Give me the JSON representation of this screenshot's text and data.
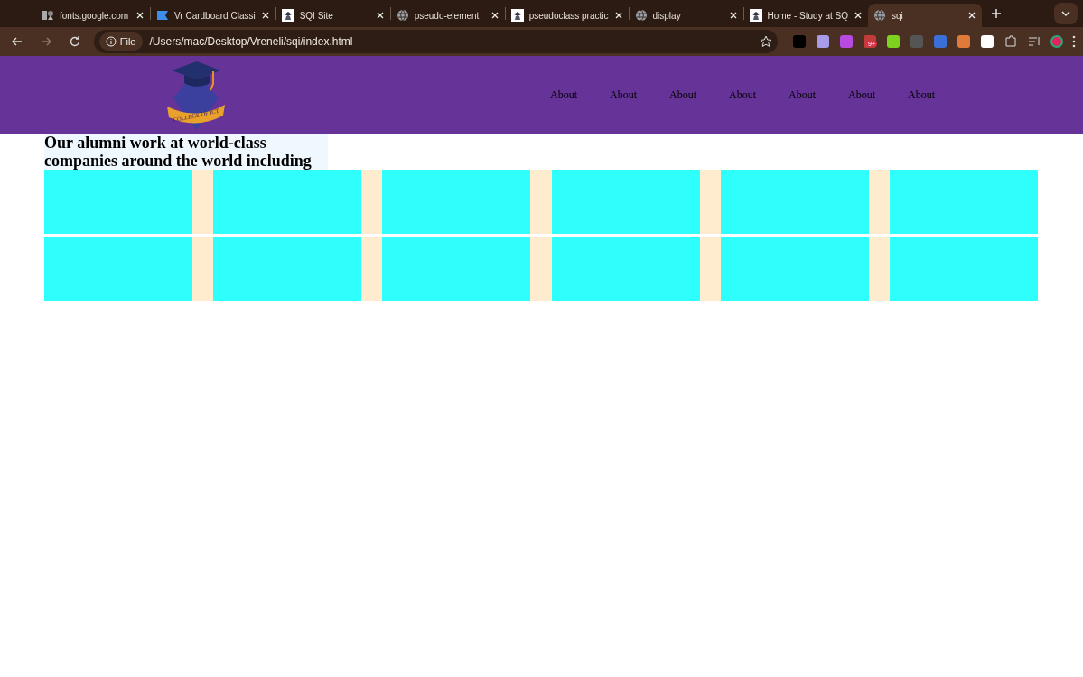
{
  "tabs": [
    {
      "title": "fonts.google.com",
      "kind": "fonts",
      "selected": false
    },
    {
      "title": "Vr Cardboard Classi",
      "kind": "flag",
      "selected": false
    },
    {
      "title": "SQI Site",
      "kind": "site",
      "selected": false
    },
    {
      "title": "pseudo-element",
      "kind": "globe",
      "selected": false
    },
    {
      "title": "pseudoclass practic",
      "kind": "site",
      "selected": false
    },
    {
      "title": "display",
      "kind": "globe",
      "selected": false
    },
    {
      "title": "Home - Study at SQ",
      "kind": "site",
      "selected": false
    },
    {
      "title": "sqi",
      "kind": "globe",
      "selected": true
    }
  ],
  "address_bar": {
    "scheme_label": "File",
    "url": "/Users/mac/Desktop/Vreneli/sqi/index.html"
  },
  "extensions": [
    {
      "kind": "plain"
    },
    {
      "kind": "plain"
    },
    {
      "kind": "plain"
    },
    {
      "kind": "badge",
      "badge": "9+"
    },
    {
      "kind": "plain"
    },
    {
      "kind": "plain"
    },
    {
      "kind": "plain"
    },
    {
      "kind": "plain"
    },
    {
      "kind": "plain"
    }
  ],
  "site_header": {
    "logo_text": "COLLEGE OF ICT",
    "nav": [
      "About",
      "About",
      "About",
      "About",
      "About",
      "About",
      "About"
    ]
  },
  "alumni": {
    "heading": "Our alumni work at world-class companies around the world including"
  }
}
